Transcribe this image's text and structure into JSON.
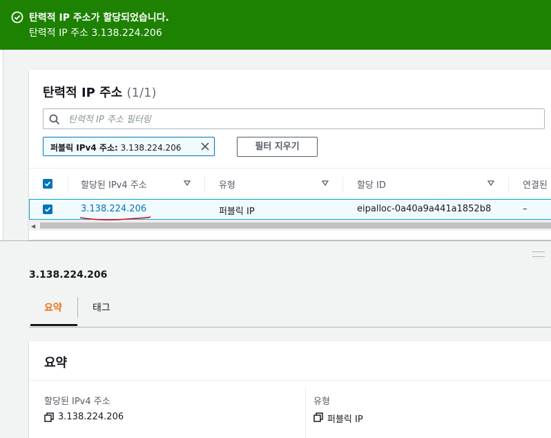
{
  "flash": {
    "title": "탄력적 IP 주소가 할당되었습니다.",
    "message": "탄력적 IP 주소 3.138.224.206",
    "icon": "check-circle-icon",
    "color": "#1d8102"
  },
  "table_panel": {
    "title": "탄력적 IP 주소",
    "count": "(1/1)",
    "search_placeholder": "탄력적 IP 주소 필터링",
    "filter_token": {
      "key": "퍼블릭 IPv4 주소:",
      "value": "3.138.224.206"
    },
    "clear_filters_label": "필터 지우기",
    "columns": [
      "할당된 IPv4 주소",
      "유형",
      "할당 ID",
      "연결된"
    ],
    "rows": [
      {
        "ip": "3.138.224.206",
        "type": "퍼블릭 IP",
        "allocation_id": "eipalloc-0a40a9a441a1852b8",
        "associated": "–",
        "selected": true
      }
    ]
  },
  "detail": {
    "title": "3.138.224.206",
    "tabs": [
      {
        "label": "요약",
        "active": true
      },
      {
        "label": "태그",
        "active": false
      }
    ],
    "summary": {
      "heading": "요약",
      "fields": [
        {
          "label": "할당된 IPv4 주소",
          "value": "3.138.224.206"
        },
        {
          "label": "유형",
          "value": "퍼블릭 IP"
        }
      ]
    }
  },
  "colors": {
    "accent": "#0073bb",
    "active_tab": "#ec7211",
    "selected_row_border": "#00a1c9"
  }
}
